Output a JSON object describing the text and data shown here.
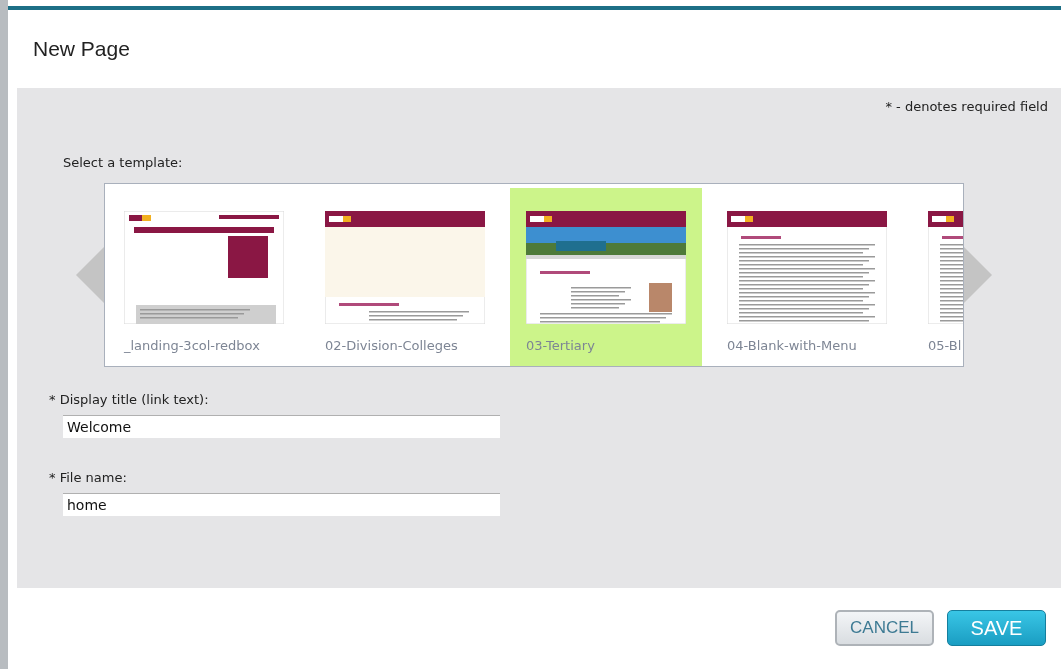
{
  "dialog": {
    "title": "New Page",
    "required_note": "* - denotes required field"
  },
  "template_picker": {
    "label": "Select a template:",
    "templates": [
      {
        "name": "_landing-3col-redbox",
        "kind": "redbox",
        "selected": false
      },
      {
        "name": "02-Division-Colleges",
        "kind": "plain",
        "selected": false
      },
      {
        "name": "03-Tertiary",
        "kind": "profile",
        "selected": true
      },
      {
        "name": "04-Blank-with-Menu",
        "kind": "text",
        "selected": false
      },
      {
        "name": "05-Bl",
        "kind": "text",
        "selected": false
      }
    ]
  },
  "fields": [
    {
      "label": "* Display title (link text):",
      "value": "Welcome"
    },
    {
      "label": "* File name:",
      "value": "home"
    }
  ],
  "buttons": [
    {
      "label": "CANCEL",
      "kind": "secondary"
    },
    {
      "label": "SAVE",
      "kind": "primary"
    }
  ]
}
